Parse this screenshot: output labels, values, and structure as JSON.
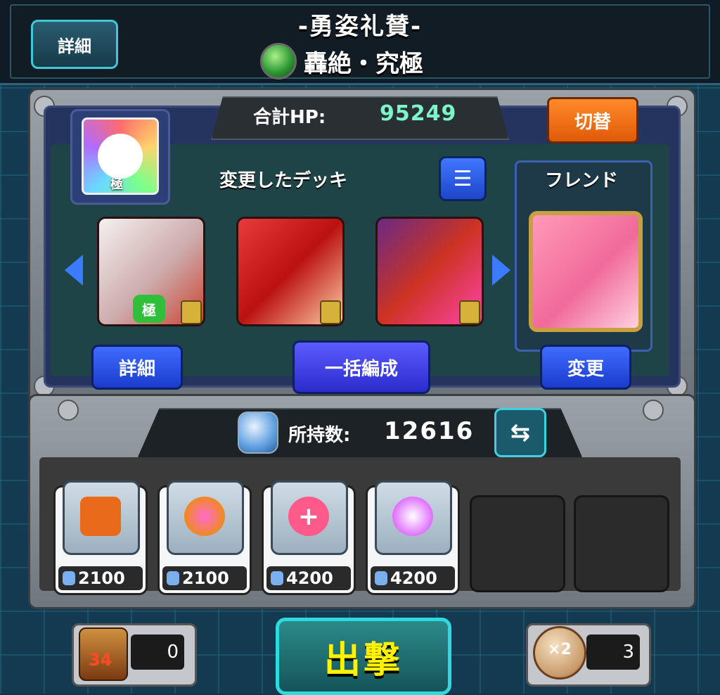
{
  "header": {
    "detail_button": "詳細",
    "quest_title": "-勇姿礼賛-",
    "quest_subtitle": "轟絶・究極",
    "element_icon": "wood-element-icon"
  },
  "deck": {
    "total_hp_label": "合計HP:",
    "total_hp_value": "95249",
    "switch_button": "切替",
    "deck_name": "変更したデッキ",
    "list_icon": "list-icon",
    "friend_label": "フレンド",
    "leader_badge": "極",
    "units": [
      {
        "name": "unit-1",
        "badge": "極",
        "locked": true
      },
      {
        "name": "unit-2",
        "locked": true
      },
      {
        "name": "unit-3",
        "locked": true
      },
      {
        "name": "friend-unit",
        "locked": false
      }
    ],
    "detail_button": "詳細",
    "bulk_button": "一括編成",
    "change_button": "変更"
  },
  "items": {
    "owned_label": "所持数:",
    "owned_value": "12616",
    "list": [
      {
        "name": "treasure-chest-icon",
        "price": "2100",
        "color": "#e86a1a"
      },
      {
        "name": "orb-speed-icon",
        "price": "2100",
        "color": "#f08a20"
      },
      {
        "name": "heart-heal-icon",
        "price": "4200",
        "color": "#ff5a8a"
      },
      {
        "name": "sparkle-orb-icon",
        "price": "4200",
        "color": "#e070ff"
      }
    ]
  },
  "footer": {
    "dice_count": "0",
    "dice_faces": "34",
    "sortie_button": "出撃",
    "boost_count": "3",
    "boost_label": "×2"
  }
}
